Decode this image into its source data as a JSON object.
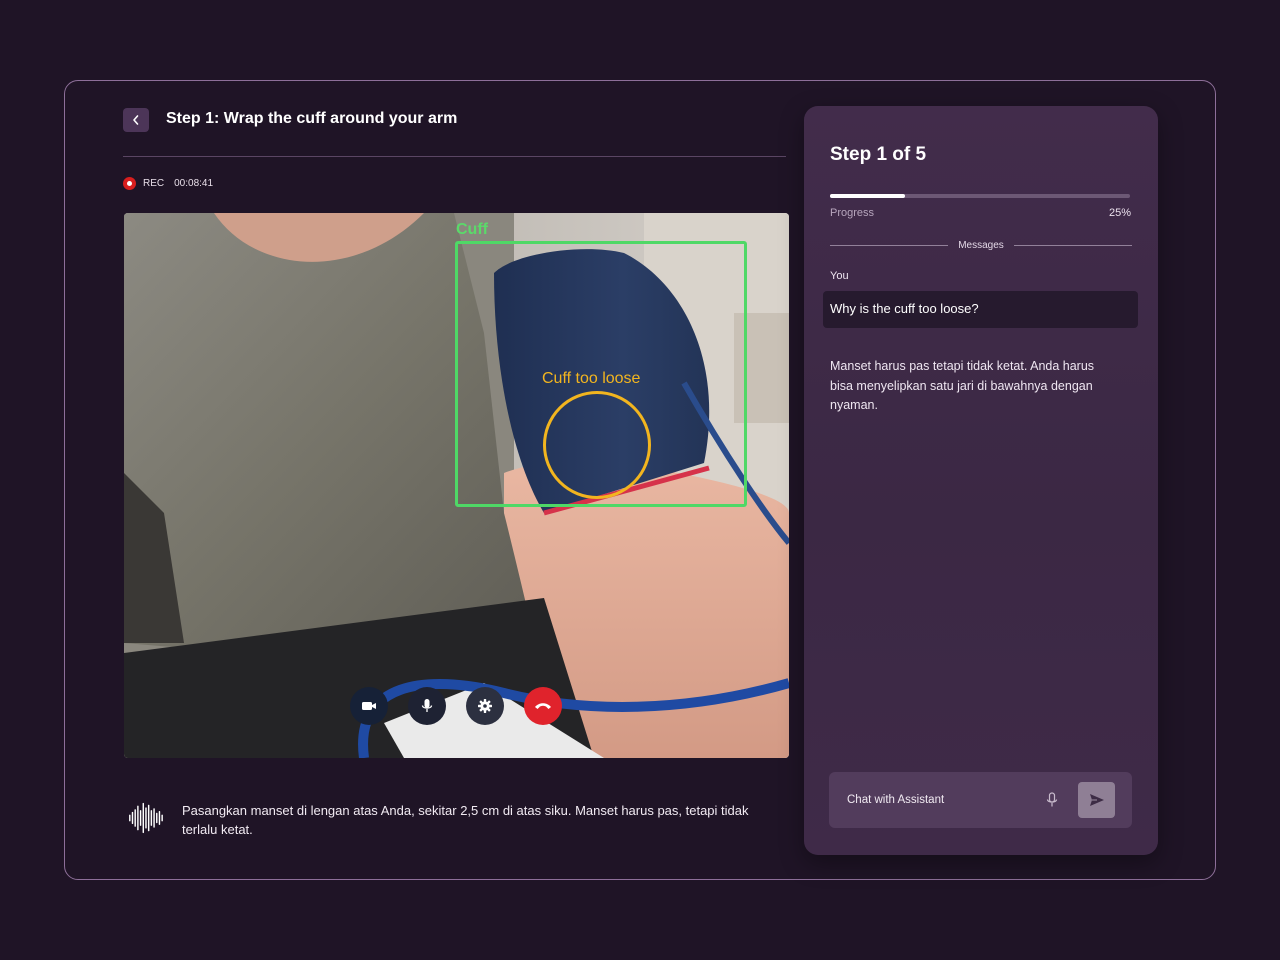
{
  "header": {
    "back_icon": "chevron-left-icon",
    "title": "Step 1: Wrap the cuff around your arm"
  },
  "recording": {
    "label": "REC",
    "time": "00:08:41",
    "color": "#d81e1e"
  },
  "video": {
    "detections": [
      {
        "label": "Cuff",
        "color": "#4fd866"
      },
      {
        "label": "Cuff too loose",
        "color": "#f2b51f"
      }
    ],
    "controls": [
      {
        "name": "camera-icon"
      },
      {
        "name": "microphone-icon"
      },
      {
        "name": "settings-icon"
      },
      {
        "name": "end-call-icon"
      }
    ]
  },
  "caption": {
    "icon": "audio-waveform-icon",
    "text": "Pasangkan manset di lengan atas Anda, sekitar 2,5 cm di atas siku. Manset harus pas, tetapi tidak terlalu ketat."
  },
  "panel": {
    "title": "Step 1 of 5",
    "progress_label": "Progress",
    "progress_value": "25%",
    "progress_fraction": 0.25,
    "messages_label": "Messages",
    "messages": [
      {
        "sender": "You",
        "text": "Why is the cuff too loose?"
      },
      {
        "sender": "",
        "text": "Manset harus pas tetapi tidak ketat. Anda harus bisa menyelipkan satu jari di bawahnya dengan nyaman."
      }
    ],
    "input_placeholder": "Chat with Assistant",
    "mic_icon": "microphone-icon",
    "send_icon": "send-icon"
  }
}
